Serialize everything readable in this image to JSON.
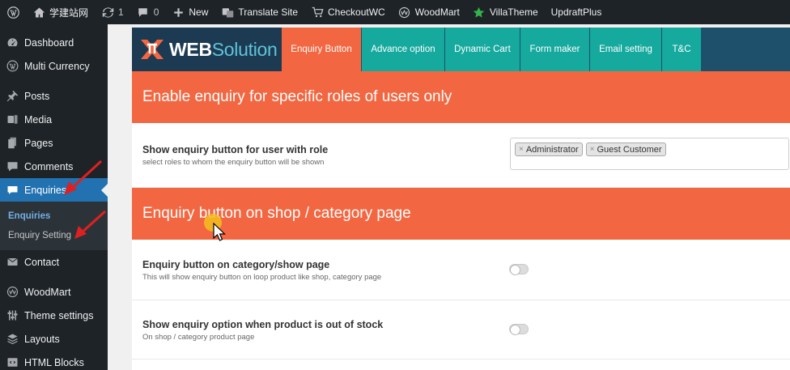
{
  "adminbar": {
    "site_name": "学建站网",
    "updates_count": "1",
    "comments_count": "0",
    "new_label": "New",
    "translate_label": "Translate Site",
    "checkout_label": "CheckoutWC",
    "woodmart_label": "WoodMart",
    "villatheme_label": "VillaTheme",
    "updraft_label": "UpdraftPlus"
  },
  "sidebar": {
    "items": [
      {
        "label": "Dashboard",
        "icon": "dashboard-icon"
      },
      {
        "label": "Multi Currency",
        "icon": "wordpress-icon"
      },
      {
        "label": "Posts",
        "icon": "pin-icon"
      },
      {
        "label": "Media",
        "icon": "media-icon"
      },
      {
        "label": "Pages",
        "icon": "page-icon"
      },
      {
        "label": "Comments",
        "icon": "comment-icon"
      },
      {
        "label": "Enquiries",
        "icon": "quote-icon"
      },
      {
        "label": "Contact",
        "icon": "mail-icon"
      },
      {
        "label": "WoodMart",
        "icon": "woodmart-icon"
      },
      {
        "label": "Theme settings",
        "icon": "sliders-icon"
      },
      {
        "label": "Layouts",
        "icon": "layers-icon"
      },
      {
        "label": "HTML Blocks",
        "icon": "code-icon"
      }
    ],
    "submenu": [
      "Enquiries",
      "Enquiry Setting"
    ]
  },
  "logo": {
    "brand": "WEB",
    "brand_accent": "Solution"
  },
  "tabs": [
    "Enquiry Button",
    "Advance option",
    "Dynamic Cart",
    "Form maker",
    "Email setting",
    "T&C"
  ],
  "sections": [
    {
      "heading": "Enable enquiry for specific roles of users only",
      "rows": [
        {
          "title": "Show enquiry button for user with role",
          "desc": "select roles to whom the enquiry button will be shown",
          "chips": [
            "Administrator",
            "Guest Customer"
          ]
        }
      ]
    },
    {
      "heading": "Enquiry button on shop / category page",
      "rows": [
        {
          "title": "Enquiry button on category/show page",
          "desc": "This will show enquiry button on loop product like shop, category page",
          "enabled": false
        },
        {
          "title": "Show enquiry option when product is out of stock",
          "desc": "On shop / category product page",
          "enabled": false
        }
      ]
    }
  ],
  "colors": {
    "accent": "#f26741",
    "tab": "#16a99e",
    "header": "#1e4f6b",
    "admin": "#1d2327",
    "wp_blue": "#2271b1"
  }
}
